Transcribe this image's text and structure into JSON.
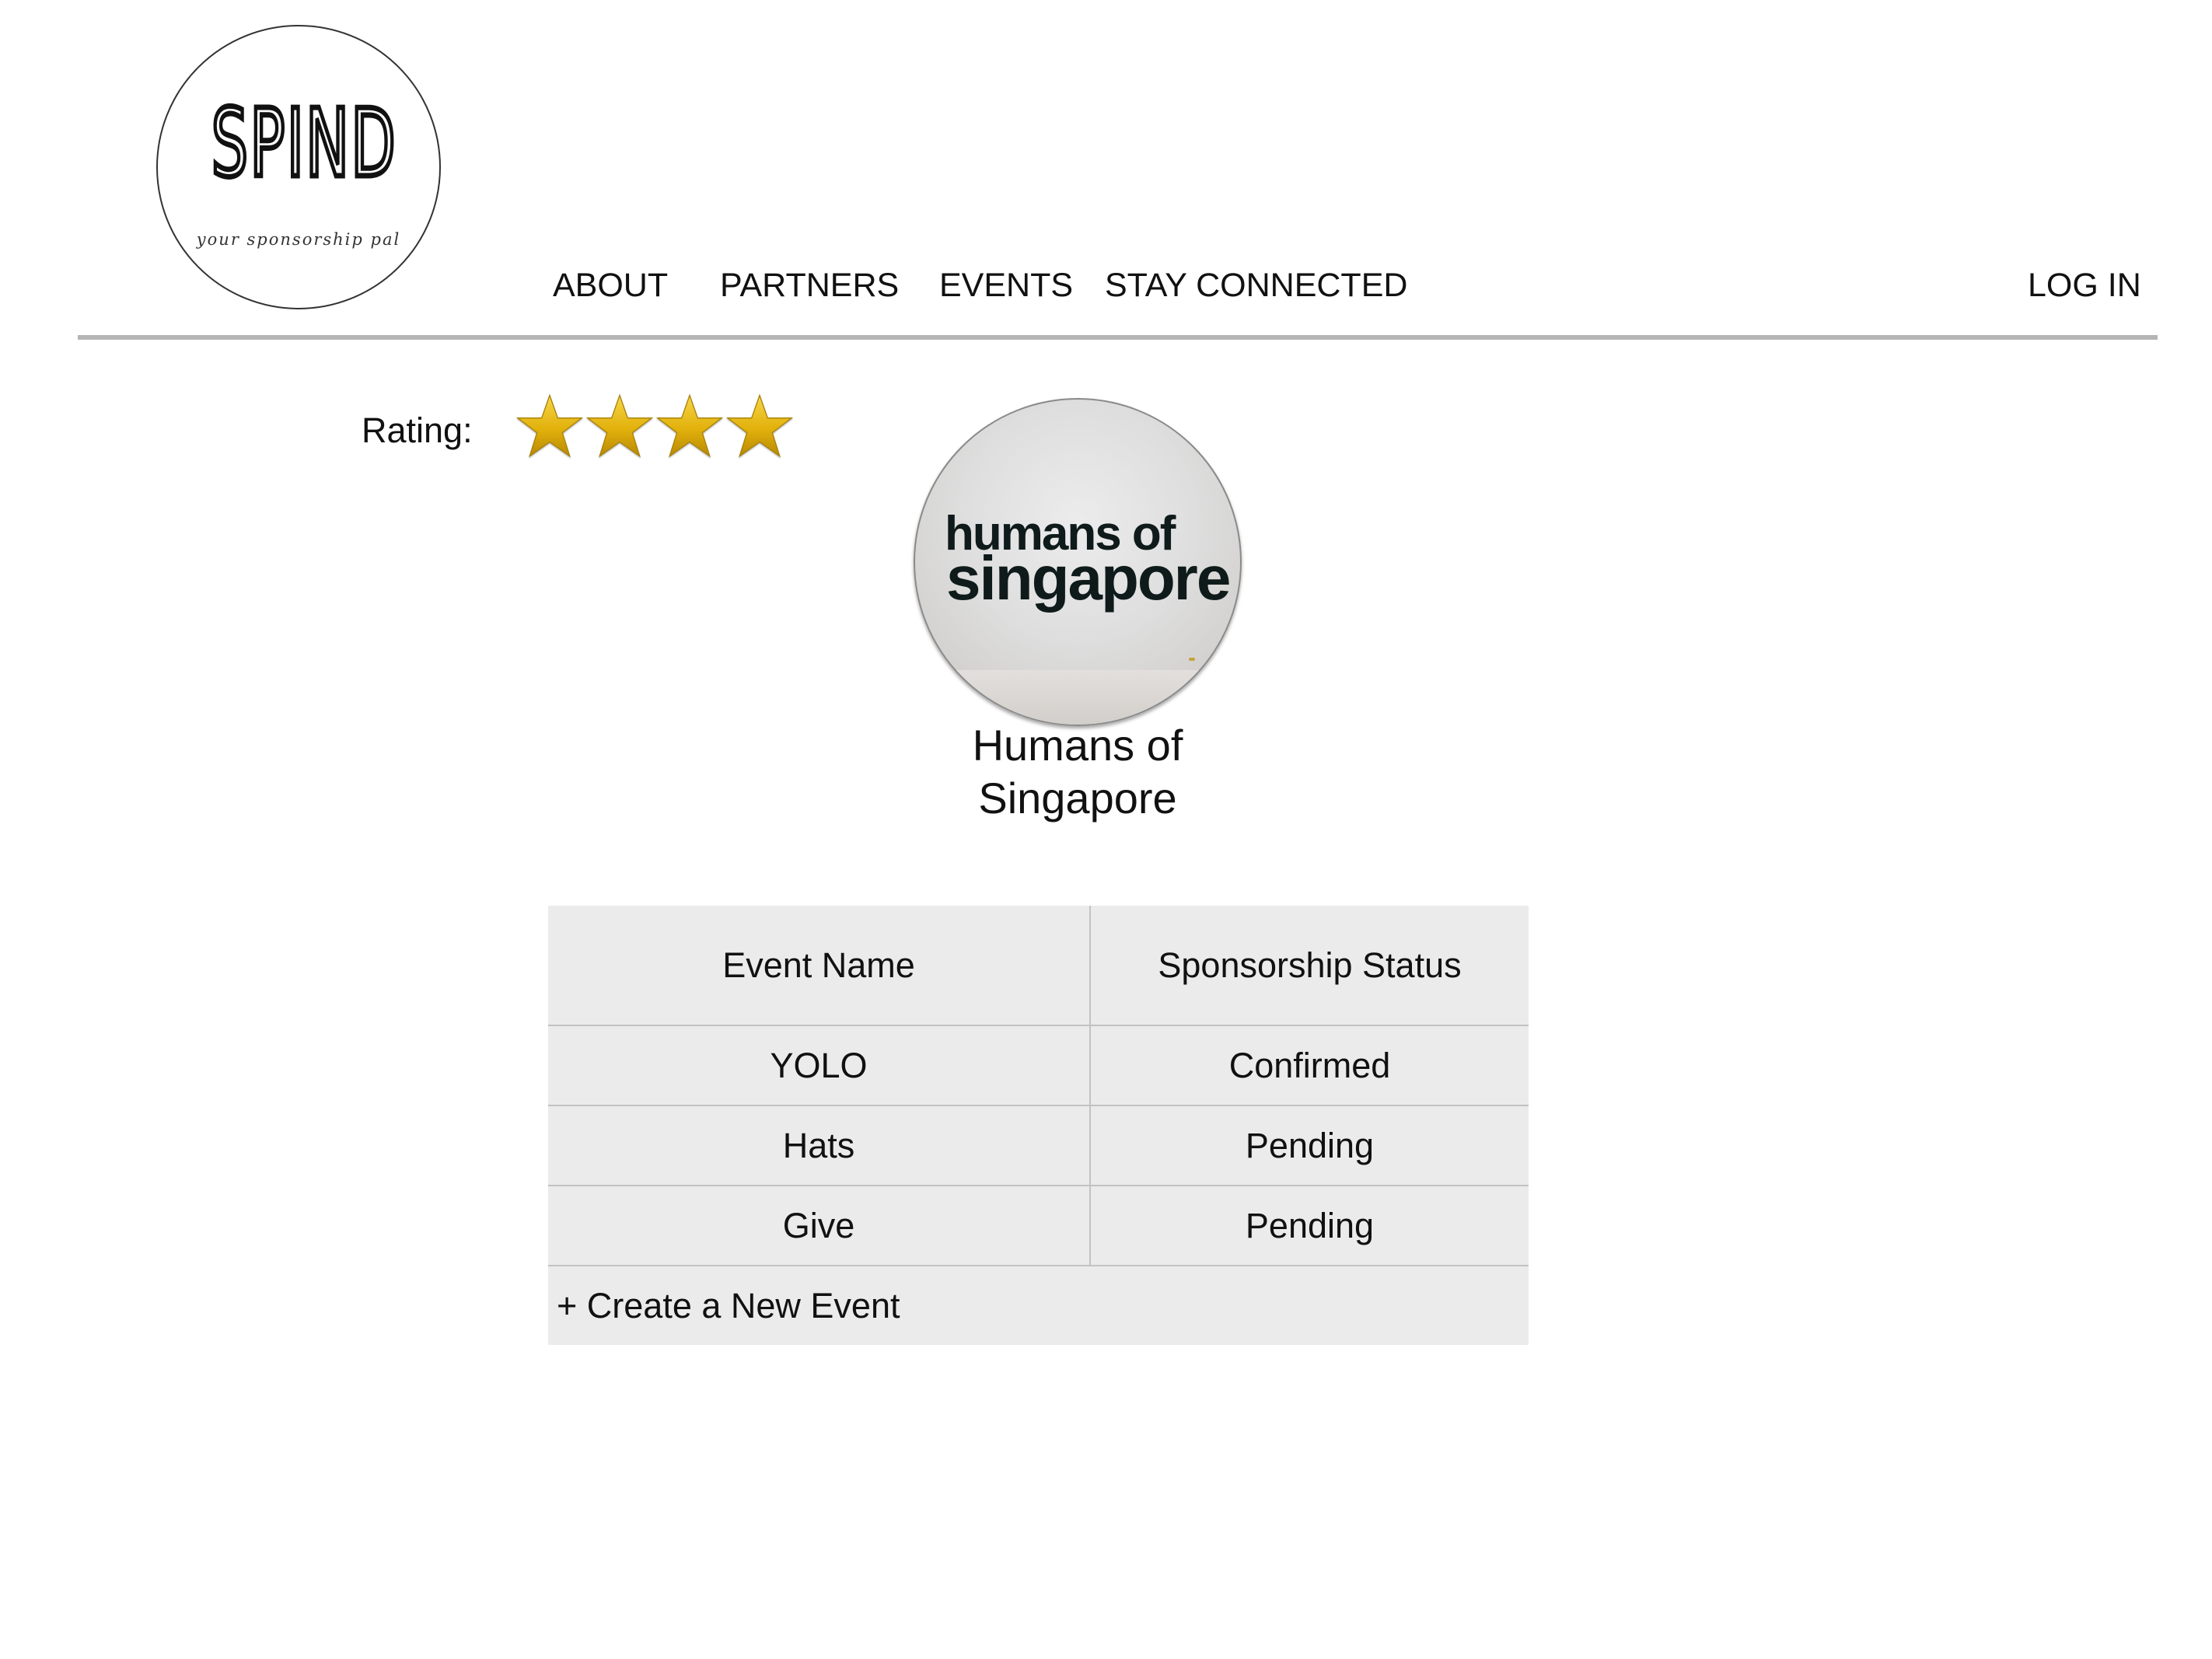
{
  "logo": {
    "wordmark": "SPIND",
    "tagline": "your sponsorship pal"
  },
  "nav": {
    "items": [
      "ABOUT",
      "PARTNERS",
      "EVENTS",
      "STAY CONNECTED"
    ],
    "login": "LOG IN"
  },
  "rating": {
    "label": "Rating:",
    "stars": 4,
    "star_color": "#E8B70E"
  },
  "profile": {
    "avatar_text_line1": "humans of",
    "avatar_text_line2": "singapore",
    "name": "Humans of Singapore"
  },
  "events_table": {
    "headers": [
      "Event Name",
      "Sponsorship Status"
    ],
    "rows": [
      {
        "event": "YOLO",
        "status": "Confirmed"
      },
      {
        "event": "Hats",
        "status": "Pending"
      },
      {
        "event": "Give",
        "status": "Pending"
      }
    ],
    "create_label": "+ Create a New Event"
  },
  "colors": {
    "table_background": "#EBEBEB",
    "divider": "#B5B5B5"
  }
}
